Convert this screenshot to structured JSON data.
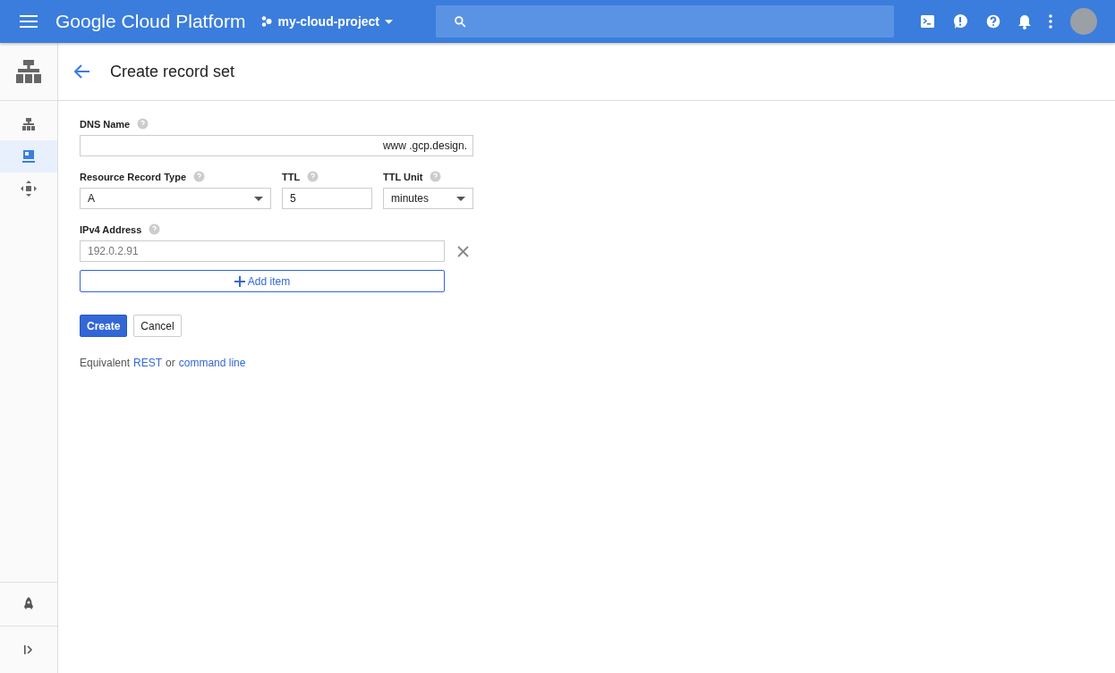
{
  "topbar": {
    "title": "Google Cloud Platform",
    "project": "my-cloud-project"
  },
  "rail": {
    "items": [
      {
        "kind": "tree",
        "selected": false
      },
      {
        "kind": "monitor",
        "selected": true
      },
      {
        "kind": "move",
        "selected": false
      }
    ]
  },
  "page": {
    "title": "Create record set"
  },
  "form": {
    "dns_name": {
      "label": "DNS Name",
      "suffix": "www .gcp.design."
    },
    "record_type": {
      "label": "Resource Record Type",
      "value": "A"
    },
    "ttl": {
      "label": "TTL",
      "value": "5"
    },
    "ttl_unit": {
      "label": "TTL Unit",
      "value": "minutes"
    },
    "ipv4": {
      "label": "IPv4 Address",
      "items": [
        {
          "placeholder": "192.0.2.91"
        }
      ],
      "add_label": "Add item"
    },
    "buttons": [
      {
        "kind": "primary",
        "label": "Create"
      },
      {
        "kind": "secondary",
        "label": "Cancel"
      }
    ],
    "footer": {
      "prefix": "Equivalent",
      "link1": "REST",
      "middle": "or",
      "link2": "command line"
    }
  }
}
